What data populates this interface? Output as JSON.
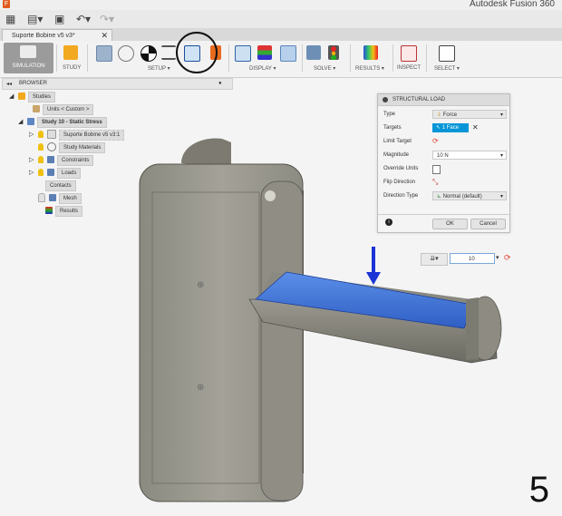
{
  "window": {
    "title": "Autodesk Fusion 360"
  },
  "tabs": [
    {
      "label": "Suporte Bobine v5 v3*"
    }
  ],
  "toolbar": {
    "workspace": "SIMULATION",
    "groups": [
      {
        "label": "STUDY"
      },
      {
        "label": "SETUP"
      },
      {
        "label": "DISPLAY"
      },
      {
        "label": "SOLVE"
      },
      {
        "label": "RESULTS"
      },
      {
        "label": "INSPECT"
      },
      {
        "label": "SELECT"
      }
    ]
  },
  "browser": {
    "title": "BROWSER",
    "items": [
      {
        "label": "Studies"
      },
      {
        "label": "Units < Custom >"
      },
      {
        "label": "Study 10 - Static Stress"
      },
      {
        "label": "Suporte Bobine v5 v3:1"
      },
      {
        "label": "Study Materials"
      },
      {
        "label": "Constraints"
      },
      {
        "label": "Loads"
      },
      {
        "label": "Contacts"
      },
      {
        "label": "Mesh"
      },
      {
        "label": "Results"
      }
    ]
  },
  "dialog": {
    "title": "STRUCTURAL LOAD",
    "fields": {
      "type_label": "Type",
      "type_value": "Force",
      "targets_label": "Targets",
      "targets_value": "1 Face",
      "limit_target_label": "Limit Target",
      "magnitude_label": "Magnitude",
      "magnitude_value": "10 N",
      "override_units_label": "Override Units",
      "flip_direction_label": "Flip Direction",
      "direction_type_label": "Direction Type",
      "direction_type_value": "Normal (default)"
    },
    "ok_label": "OK",
    "cancel_label": "Cancel"
  },
  "manipulator": {
    "value": "10"
  },
  "step_number": "5",
  "colors": {
    "accent": "#0696d7",
    "selected_face": "#3b6fd4",
    "arrow": "#1a34d6",
    "highlight": "#111111"
  }
}
